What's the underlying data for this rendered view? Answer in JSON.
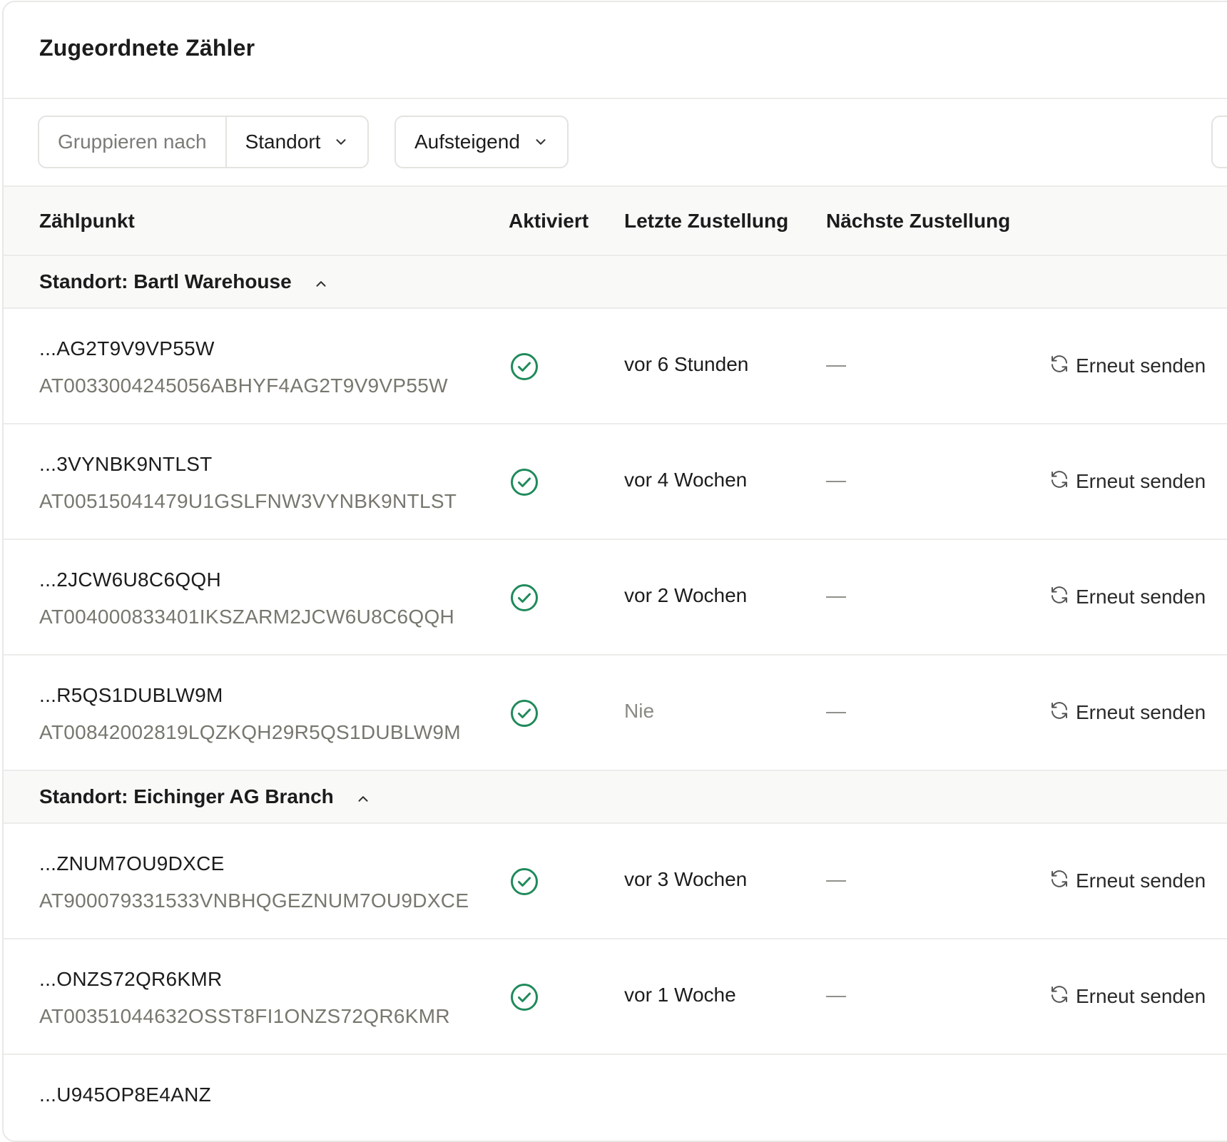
{
  "card": {
    "title": "Zugeordnete Zähler"
  },
  "toolbar": {
    "group_by_label": "Gruppieren nach",
    "group_by_value": "Standort",
    "sort_value": "Aufsteigend"
  },
  "table": {
    "columns": {
      "meter": "Zählpunkt",
      "activated": "Aktiviert",
      "last_delivery": "Letzte Zustellung",
      "next_delivery": "Nächste Zustellung"
    },
    "resend_label": "Erneut senden",
    "groups": [
      {
        "label": "Standort: Bartl Warehouse",
        "rows": [
          {
            "short": "...AG2T9V9VP55W",
            "full": "AT0033004245056ABHYF4AG2T9V9VP55W",
            "last": "vor 6 Stunden",
            "next": "—"
          },
          {
            "short": "...3VYNBK9NTLST",
            "full": "AT00515041479U1GSLFNW3VYNBK9NTLST",
            "last": "vor 4 Wochen",
            "next": "—"
          },
          {
            "short": "...2JCW6U8C6QQH",
            "full": "AT004000833401IKSZARM2JCW6U8C6QQH",
            "last": "vor 2 Wochen",
            "next": "—"
          },
          {
            "short": "...R5QS1DUBLW9M",
            "full": "AT00842002819LQZKQH29R5QS1DUBLW9M",
            "last": "Nie",
            "next": "—"
          }
        ]
      },
      {
        "label": "Standort: Eichinger AG Branch",
        "rows": [
          {
            "short": "...ZNUM7OU9DXCE",
            "full": "AT900079331533VNBHQGEZNUM7OU9DXCE",
            "last": "vor 3 Wochen",
            "next": "—"
          },
          {
            "short": "...ONZS72QR6KMR",
            "full": "AT00351044632OSST8FI1ONZS72QR6KMR",
            "last": "vor 1 Woche",
            "next": "—"
          },
          {
            "short": "...U945OP8E4ANZ",
            "full": "",
            "last": "",
            "next": ""
          }
        ]
      }
    ]
  },
  "colors": {
    "accent_green": "#1f8a5b",
    "border": "#ececea",
    "muted_text": "#77776f"
  },
  "icons": {
    "check": "check-circle-icon",
    "resend": "refresh-icon",
    "chevron": "chevron-down-icon",
    "caret": "chevron-up-icon"
  }
}
